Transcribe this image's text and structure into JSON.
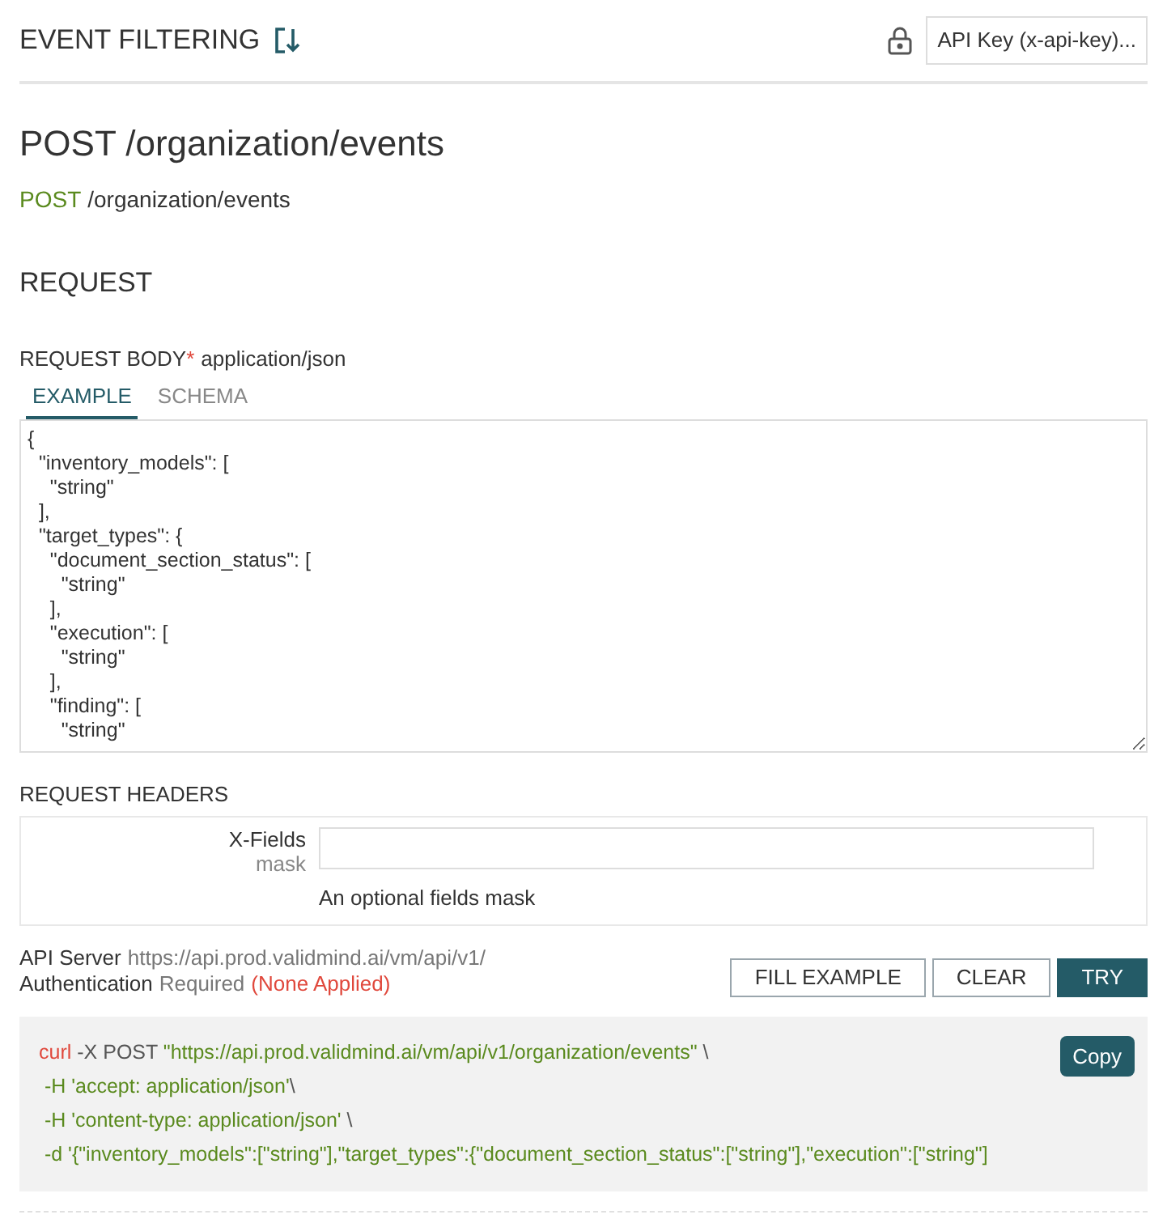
{
  "header": {
    "title": "EVENT FILTERING",
    "auth_button": "API Key (x-api-key)..."
  },
  "endpoint": {
    "title": "POST /organization/events",
    "method": "POST",
    "path": "/organization/events"
  },
  "request": {
    "heading": "REQUEST",
    "body_label": "REQUEST BODY",
    "required_mark": "*",
    "content_type": "application/json",
    "tabs": [
      {
        "label": "EXAMPLE",
        "selected": true
      },
      {
        "label": "SCHEMA",
        "selected": false
      }
    ],
    "body_value": "{\n  \"inventory_models\": [\n    \"string\"\n  ],\n  \"target_types\": {\n    \"document_section_status\": [\n      \"string\"\n    ],\n    \"execution\": [\n      \"string\"\n    ],\n    \"finding\": [\n      \"string\""
  },
  "headers": {
    "heading": "REQUEST HEADERS",
    "params": [
      {
        "name": "X-Fields",
        "type": "mask",
        "description": "An optional fields mask"
      }
    ]
  },
  "server": {
    "label": "API Server",
    "url": "https://api.prod.validmind.ai/vm/api/v1/",
    "auth_label": "Authentication",
    "auth_value": "Required",
    "auth_status": "(None Applied)"
  },
  "buttons": [
    {
      "label": "FILL EXAMPLE",
      "kind": "outline"
    },
    {
      "label": "CLEAR",
      "kind": "outline"
    },
    {
      "label": "TRY",
      "kind": "primary"
    }
  ],
  "curl": {
    "copy": "Copy",
    "lines": [
      [
        {
          "text": "curl",
          "kind": "command"
        },
        {
          "text": " -X POST ",
          "kind": "option"
        },
        {
          "text": "\"https://api.prod.validmind.ai/vm/api/v1/organization/events\"",
          "kind": "string"
        },
        {
          "text": " \\",
          "kind": "option"
        }
      ],
      [
        {
          "text": " -H 'accept: application/json'",
          "kind": "string"
        },
        {
          "text": "\\",
          "kind": "option"
        }
      ],
      [
        {
          "text": " -H 'content-type: application/json'",
          "kind": "string"
        },
        {
          "text": " \\",
          "kind": "option"
        }
      ],
      [
        {
          "text": " -d '{\"inventory_models\":[\"string\"],\"target_types\":{\"document_section_status\":[\"string\"],\"execution\":[\"string\"]",
          "kind": "string"
        }
      ]
    ]
  }
}
